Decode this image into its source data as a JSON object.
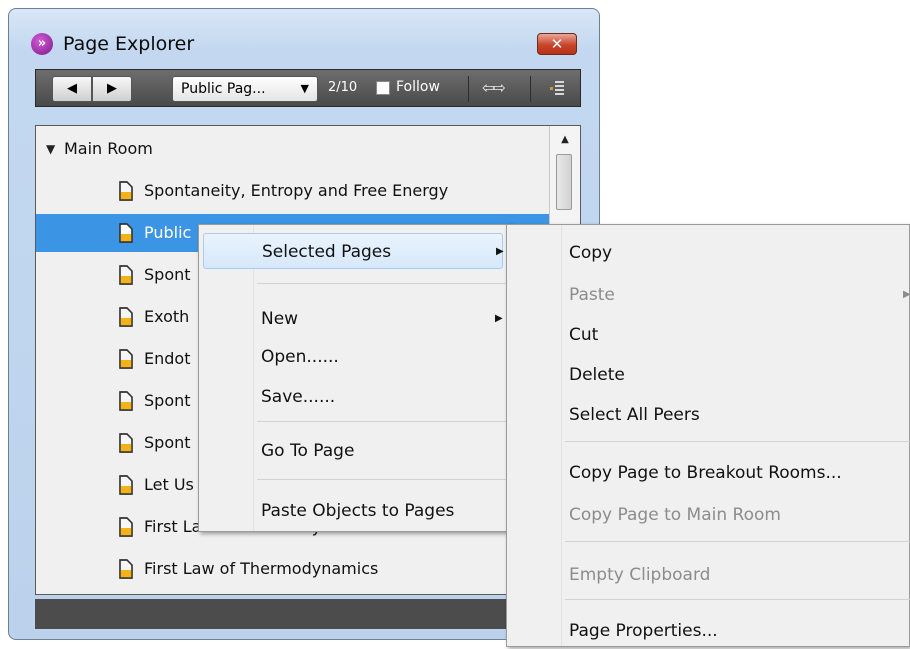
{
  "window": {
    "title": "Page Explorer",
    "close_icon": "✕"
  },
  "toolbar": {
    "prev_icon": "◀",
    "next_icon": "▶",
    "page_select_value": "Public Pag...",
    "page_select_arrow": "▼",
    "page_count": "2/10",
    "follow_label": "Follow",
    "swap_icon": "⇦⇨"
  },
  "tree": {
    "root_label": "Main Room",
    "expand_icon": "▼",
    "rows": [
      "Spontaneity, Entropy and Free Energy",
      "Public Page 2",
      "Spont",
      "Exoth",
      "Endot",
      "Spont",
      "Spont",
      "Let Us",
      "First Law of Thermodynamics",
      "First Law of Thermodynamics"
    ],
    "scroll_up_icon": "▲"
  },
  "context_menu": {
    "items": [
      {
        "label": "Selected Pages",
        "has_submenu": true
      },
      {
        "label": "New",
        "has_submenu": true
      },
      {
        "label": "Open......"
      },
      {
        "label": "Save......"
      },
      {
        "label": "Go To Page"
      },
      {
        "label": "Paste Objects to Pages"
      }
    ],
    "submenu_arrow": "▶"
  },
  "submenu": {
    "items": [
      {
        "label": "Copy",
        "disabled": false
      },
      {
        "label": "Paste",
        "disabled": true,
        "has_submenu": true
      },
      {
        "label": "Cut",
        "disabled": false
      },
      {
        "label": "Delete",
        "disabled": false
      },
      {
        "label": "Select All Peers",
        "disabled": false
      },
      {
        "label": "Copy Page to Breakout Rooms...",
        "disabled": false
      },
      {
        "label": "Copy Page to Main Room",
        "disabled": true
      },
      {
        "label": "Empty Clipboard",
        "disabled": true
      },
      {
        "label": "Page Properties...",
        "disabled": false
      }
    ]
  },
  "colors": {
    "selection": "#3c95e4",
    "toolbar": "#4a4a4a",
    "close_button": "#c9452a",
    "app_icon": "#7a1a86"
  }
}
